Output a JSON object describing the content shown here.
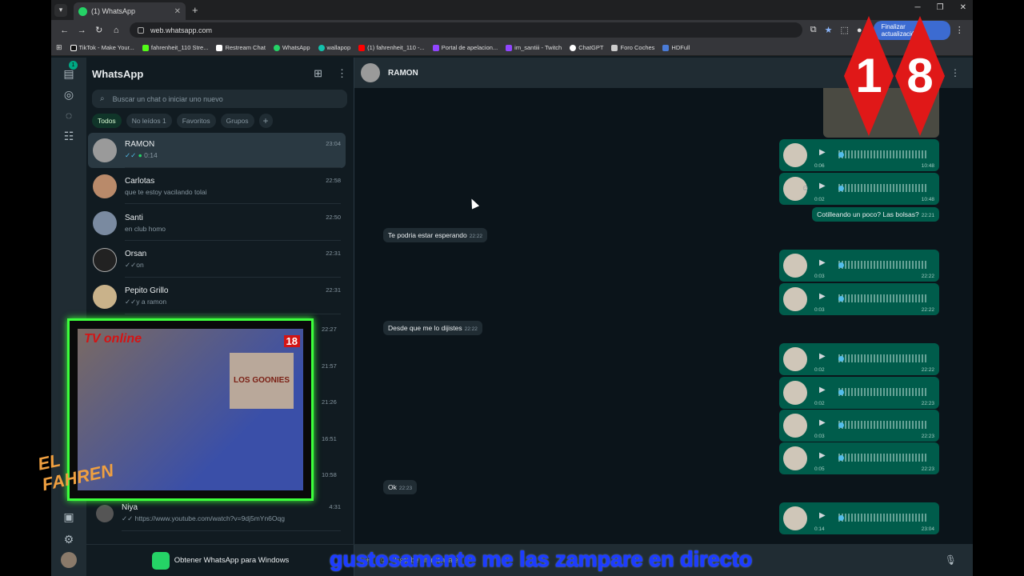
{
  "browser": {
    "tab_title": "(1) WhatsApp",
    "url": "web.whatsapp.com",
    "update_button": "Finalizar actualización",
    "bookmarks": [
      "TikTok - Make Your...",
      "fahrenheit_110 Stre...",
      "Restream Chat",
      "WhatsApp",
      "wallapop",
      "(1) fahrenheit_110 -...",
      "Portal de apelacion...",
      "im_santiii - Twitch",
      "ChatGPT",
      "Foro Coches",
      "HDFull"
    ]
  },
  "sidebar": {
    "title": "WhatsApp",
    "search_placeholder": "Buscar un chat o iniciar uno nuevo",
    "filters": [
      "Todos",
      "No leídos 1",
      "Favoritos",
      "Grupos",
      "+"
    ],
    "unread_badge": "1",
    "chats": [
      {
        "name": "RAMON",
        "preview": "0:14",
        "time": "23:04"
      },
      {
        "name": "Carlotas",
        "preview": "que te estoy vacilando tolai",
        "time": "22:58"
      },
      {
        "name": "Santi",
        "preview": "en club homo",
        "time": "22:50"
      },
      {
        "name": "Orsan",
        "preview": "on",
        "time": "22:31"
      },
      {
        "name": "Pepito Grillo",
        "preview": "y a ramon",
        "time": "22:31"
      },
      {
        "name": "",
        "preview": "",
        "time": "22:27"
      },
      {
        "name": "",
        "preview": "",
        "time": "21:57"
      },
      {
        "name": "",
        "preview": "",
        "time": "21:26"
      },
      {
        "name": "",
        "preview": "",
        "time": "16:51"
      },
      {
        "name": "",
        "preview": "",
        "time": "10:58"
      },
      {
        "name": "Niya",
        "preview": "https://www.youtube.com/watch?v=9dj5mYn6Oqg",
        "time": "4:31"
      }
    ],
    "get_app": "Obtener WhatsApp para Windows"
  },
  "conversation": {
    "contact": "RAMON",
    "composer_placeholder": "Escribe un mensaje",
    "incoming": [
      {
        "text": "Te podria estar esperando",
        "time": "22:22"
      },
      {
        "text": "Desde que me lo dijistes",
        "time": "22:22"
      },
      {
        "text": "Ok",
        "time": "22:23"
      }
    ],
    "outgoing_text": {
      "text": "Cotilleando un poco? Las bolsas?",
      "time": "22:21"
    },
    "voice_notes": [
      {
        "duration": "0:06",
        "time": "10:48"
      },
      {
        "duration": "0:02",
        "time": "10:48"
      },
      {
        "duration": "0:03",
        "time": "22:22"
      },
      {
        "duration": "0:03",
        "time": "22:22"
      },
      {
        "duration": "0:02",
        "time": "22:22"
      },
      {
        "duration": "0:02",
        "time": "22:23"
      },
      {
        "duration": "0:03",
        "time": "22:23"
      },
      {
        "duration": "0:05",
        "time": "22:23"
      },
      {
        "duration": "0:14",
        "time": "23:04"
      }
    ]
  },
  "overlays": {
    "tv_label": "TV online",
    "badge_18": [
      "1",
      "8"
    ],
    "logo": "EL FAHREN",
    "subtitle": "gustosamente me las zampare en directo",
    "poster": "LOS GOONIES"
  }
}
